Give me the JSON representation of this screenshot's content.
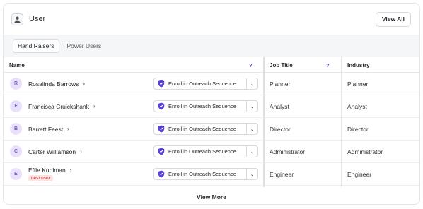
{
  "header": {
    "title": "User",
    "view_all_label": "View All"
  },
  "tabs": [
    {
      "label": "Hand Raisers",
      "active": true
    },
    {
      "label": "Power Users",
      "active": false
    }
  ],
  "table": {
    "columns": {
      "name": "Name",
      "job_title": "Job Title",
      "industry": "Industry",
      "help": "?"
    },
    "enroll_label": "Enroll in Outreach Sequence",
    "rows": [
      {
        "initial": "R",
        "name": "Rosalinda Barrows",
        "badge": "",
        "job_title": "Planner",
        "industry": "Planner"
      },
      {
        "initial": "F",
        "name": "Francisca Cruickshank",
        "badge": "",
        "job_title": "Analyst",
        "industry": "Analyst"
      },
      {
        "initial": "B",
        "name": "Barrett Feest",
        "badge": "",
        "job_title": "Director",
        "industry": "Director"
      },
      {
        "initial": "C",
        "name": "Carter Williamson",
        "badge": "",
        "job_title": "Administrator",
        "industry": "Administrator"
      },
      {
        "initial": "E",
        "name": "Effie Kuhlman",
        "badge": "best user",
        "job_title": "Engineer",
        "industry": "Engineer"
      }
    ]
  },
  "footer": {
    "view_more_label": "View More"
  },
  "colors": {
    "accent": "#5b3fd6",
    "avatar_bg": "#e9e1fb",
    "badge_bg": "#fde2e2",
    "badge_text": "#c43a3a"
  },
  "icons": {
    "header": "user-icon",
    "enroll": "shield-icon",
    "caret": "chevron-down-icon",
    "name_link": "chevron-right-icon"
  }
}
